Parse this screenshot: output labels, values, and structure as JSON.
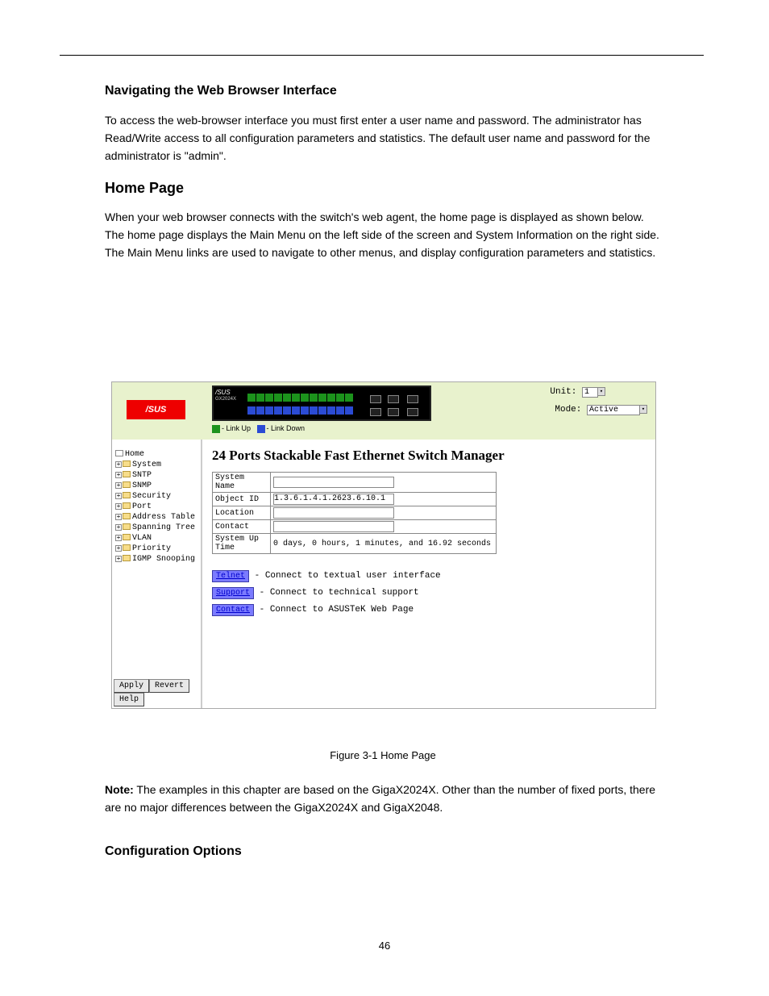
{
  "doc": {
    "section_heading": "Navigating the Web Browser Interface",
    "para1": "To access the web-browser interface you must first enter a user name and password. The administrator has Read/Write access to all configuration parameters and statistics. The default user name and password for the administrator is \"admin\".",
    "home_heading": "Home Page",
    "para2": "When your web browser connects with the switch's web agent, the home page is displayed as shown below. The home page displays the Main Menu on the left side of the screen and System Information on the right side. The Main Menu links are used to navigate to other menus, and display configuration parameters and statistics.",
    "figure_caption": "Figure 3-1 Home Page",
    "note": "Note: The examples in this chapter are based on the GigaX2024X. Other than the number of fixed ports, there are no major differences between the GigaX2024X and GigaX2048.",
    "note_label": "Note:",
    "config_heading": "Configuration Options",
    "page_no": "46"
  },
  "banner": {
    "logo": "/SUS",
    "model_small": "GX2024X",
    "legend_up": "- Link Up",
    "legend_down": "- Link Down",
    "unit_label": "Unit:",
    "unit_value": "1",
    "mode_label": "Mode:",
    "mode_value": "Active"
  },
  "tree": [
    {
      "label": "Home",
      "expandable": false
    },
    {
      "label": "System",
      "expandable": true
    },
    {
      "label": "SNTP",
      "expandable": true
    },
    {
      "label": "SNMP",
      "expandable": true
    },
    {
      "label": "Security",
      "expandable": true
    },
    {
      "label": "Port",
      "expandable": true
    },
    {
      "label": "Address Table",
      "expandable": true
    },
    {
      "label": "Spanning Tree",
      "expandable": true
    },
    {
      "label": "VLAN",
      "expandable": true
    },
    {
      "label": "Priority",
      "expandable": true
    },
    {
      "label": "IGMP Snooping",
      "expandable": true
    }
  ],
  "buttons": {
    "apply": "Apply",
    "revert": "Revert",
    "help": "Help"
  },
  "main": {
    "title": "24 Ports Stackable Fast Ethernet Switch Manager",
    "rows": [
      {
        "key": "System Name",
        "value": ""
      },
      {
        "key": "Object ID",
        "value": "1.3.6.1.4.1.2623.6.10.1"
      },
      {
        "key": "Location",
        "value": ""
      },
      {
        "key": "Contact",
        "value": ""
      },
      {
        "key": "System Up Time",
        "value": "0 days, 0 hours, 1 minutes, and 16.92 seconds"
      }
    ],
    "links": [
      {
        "btn": "Telnet",
        "desc": "- Connect to textual user interface"
      },
      {
        "btn": "Support",
        "desc": "- Connect to technical support"
      },
      {
        "btn": "Contact",
        "desc": "- Connect to ASUSTeK Web Page"
      }
    ]
  }
}
